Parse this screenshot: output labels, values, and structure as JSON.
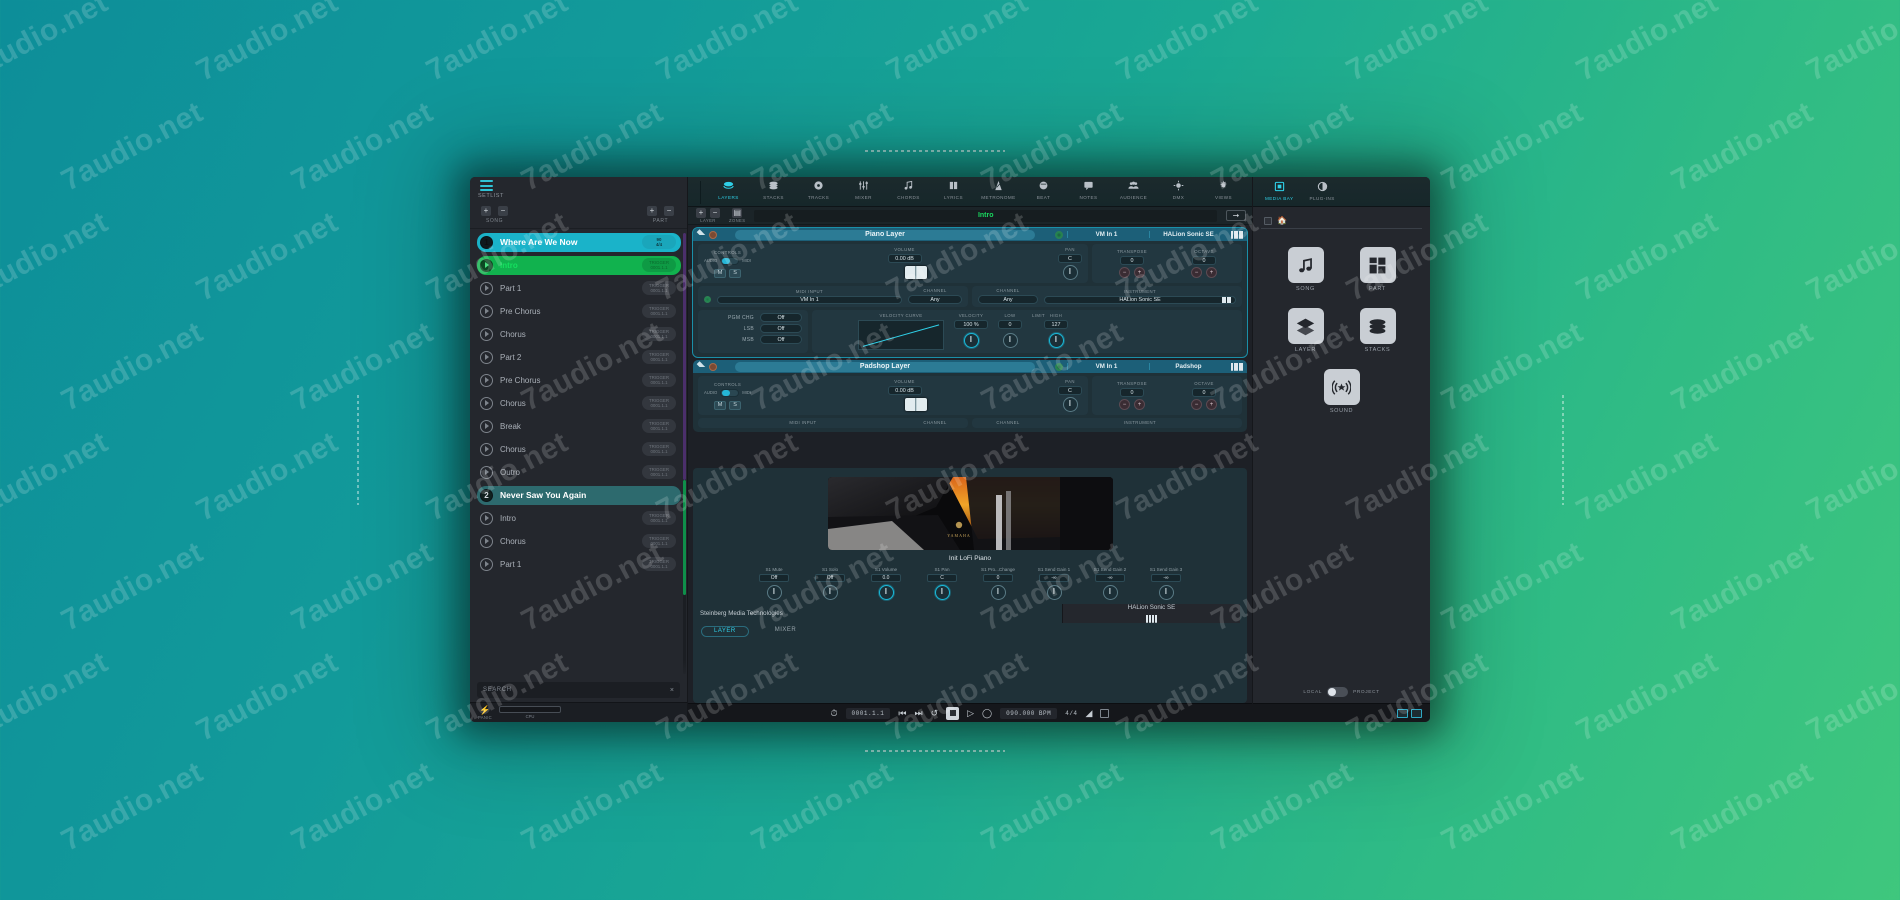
{
  "watermark": "7audio.net",
  "app": {
    "setlist": {
      "header_label": "SETLIST",
      "song_group_label": "SONG",
      "part_group_label": "PART",
      "add_icon": "plus-icon",
      "remove_icon": "minus-icon",
      "search_placeholder": "SEARCH",
      "search_clear": "×",
      "panic_label": "PANIC",
      "panic_icon": "lightning-icon",
      "cpu_label": "CPU",
      "items": [
        {
          "type": "song",
          "num": "1",
          "label": "Where Are We Now",
          "badge_line1": "90",
          "badge_line2": "4/4",
          "state": "selected"
        },
        {
          "type": "part",
          "label": "Intro",
          "badge_line1": "TRIGGER",
          "badge_line2": "0001.1.1",
          "state": "active"
        },
        {
          "type": "part",
          "label": "Part 1",
          "badge_line1": "TRIGGER",
          "badge_line2": "0001.1.1",
          "state": ""
        },
        {
          "type": "part",
          "label": "Pre Chorus",
          "badge_line1": "TRIGGER",
          "badge_line2": "0001.1.1",
          "state": ""
        },
        {
          "type": "part",
          "label": "Chorus",
          "badge_line1": "TRIGGER",
          "badge_line2": "0001.1.1",
          "state": ""
        },
        {
          "type": "part",
          "label": "Part 2",
          "badge_line1": "TRIGGER",
          "badge_line2": "0001.1.1",
          "state": ""
        },
        {
          "type": "part",
          "label": "Pre Chorus",
          "badge_line1": "TRIGGER",
          "badge_line2": "0001.1.1",
          "state": ""
        },
        {
          "type": "part",
          "label": "Chorus",
          "badge_line1": "TRIGGER",
          "badge_line2": "0001.1.1",
          "state": ""
        },
        {
          "type": "part",
          "label": "Break",
          "badge_line1": "TRIGGER",
          "badge_line2": "0001.1.1",
          "state": ""
        },
        {
          "type": "part",
          "label": "Chorus",
          "badge_line1": "TRIGGER",
          "badge_line2": "0001.1.1",
          "state": ""
        },
        {
          "type": "part",
          "label": "Outro",
          "badge_line1": "TRIGGER",
          "badge_line2": "0001.1.1",
          "state": ""
        },
        {
          "type": "song2",
          "num": "2",
          "label": "Never Saw You Again",
          "badge_line1": "",
          "badge_line2": "",
          "state": ""
        },
        {
          "type": "part",
          "label": "Intro",
          "badge_line1": "TRIGGER",
          "badge_line2": "0001.1.1",
          "state": ""
        },
        {
          "type": "part",
          "label": "Chorus",
          "badge_line1": "TRIGGER",
          "badge_line2": "0001.1.1",
          "state": ""
        },
        {
          "type": "part",
          "label": "Part 1",
          "badge_line1": "TRIGGER",
          "badge_line2": "0001.1.1",
          "state": ""
        }
      ]
    },
    "toolbar": [
      {
        "label": "LAYERS",
        "icon": "layers-icon",
        "active": true
      },
      {
        "label": "STACKS",
        "icon": "stacks-icon",
        "active": false
      },
      {
        "label": "TRACKS",
        "icon": "tracks-icon",
        "active": false
      },
      {
        "label": "MIXER",
        "icon": "mixer-icon",
        "active": false
      },
      {
        "label": "CHORDS",
        "icon": "chords-icon",
        "active": false
      },
      {
        "label": "LYRICS",
        "icon": "lyrics-icon",
        "active": false
      },
      {
        "label": "METRONOME",
        "icon": "metronome-icon",
        "active": false
      },
      {
        "label": "BEAT",
        "icon": "beat-icon",
        "active": false
      },
      {
        "label": "NOTES",
        "icon": "notes-icon",
        "active": false
      },
      {
        "label": "AUDIENCE",
        "icon": "audience-icon",
        "active": false
      },
      {
        "label": "DMX",
        "icon": "dmx-icon",
        "active": false
      },
      {
        "label": "VIEWS",
        "icon": "views-icon",
        "active": false
      }
    ],
    "right_toolbar": [
      {
        "label": "MEDIA BAY",
        "icon": "media-bay-icon",
        "active": true
      },
      {
        "label": "PLUG-INS",
        "icon": "plugins-icon",
        "active": false
      }
    ],
    "subbar": {
      "layer_label": "LAYER",
      "zones_label": "ZONES",
      "part_name": "Intro",
      "arrow_icon": "arrow-right-icon"
    },
    "layers": [
      {
        "name": "Piano Layer",
        "midi_in_tag": "VM In 1",
        "instrument_tag": "HALion Sonic SE",
        "selected": true,
        "controls_label": "CONTROLS",
        "audio_label": "AUDIO",
        "midi_label": "MIDI",
        "mute_label": "M",
        "solo_label": "S",
        "volume_label": "VOLUME",
        "volume_value": "0.00 dB",
        "pan_label": "PAN",
        "pan_value": "C",
        "transpose_label": "TRANSPOSE",
        "transpose_value": "0",
        "octave_label": "OCTAVE",
        "octave_value": "0",
        "midi_input_label": "MIDI INPUT",
        "midi_input_value": "VM In 1",
        "midi_channel_label": "CHANNEL",
        "midi_channel_value": "Any",
        "out_channel_label": "CHANNEL",
        "out_channel_value": "Any",
        "instrument_label": "INSTRUMENT",
        "instrument_value": "HALion Sonic SE",
        "pgm_chg_label": "PGM CHG",
        "pgm_chg_value": "Off",
        "lsb_label": "LSB",
        "lsb_value": "Off",
        "msb_label": "MSB",
        "msb_value": "Off",
        "velocity_curve_label": "VELOCITY CURVE",
        "velocity_label": "VELOCITY",
        "velocity_value": "100 %",
        "limit_label": "LIMIT",
        "low_label": "LOW",
        "low_value": "0",
        "high_label": "HIGH",
        "high_value": "127"
      },
      {
        "name": "Padshop Layer",
        "midi_in_tag": "VM In 1",
        "instrument_tag": "Padshop",
        "selected": false,
        "controls_label": "CONTROLS",
        "audio_label": "AUDIO",
        "midi_label": "MIDI",
        "mute_label": "M",
        "solo_label": "S",
        "volume_label": "VOLUME",
        "volume_value": "0.00 dB",
        "pan_label": "PAN",
        "pan_value": "C",
        "transpose_label": "TRANSPOSE",
        "transpose_value": "0",
        "octave_label": "OCTAVE",
        "octave_value": "0",
        "midi_input_label": "MIDI INPUT",
        "midi_channel_label": "CHANNEL",
        "out_channel_label": "CHANNEL",
        "instrument_label": "INSTRUMENT"
      }
    ],
    "instrument_editor": {
      "preset_name": "Init LoFi Piano",
      "image_alt": "grand-piano-photo",
      "brand": "Steinberg Media Technologies",
      "plugin_name": "HALion Sonic SE",
      "tabs": [
        {
          "label": "LAYER",
          "active": true
        },
        {
          "label": "MIXER",
          "active": false
        }
      ],
      "params": [
        {
          "label": "S1 Mute",
          "value": "Off",
          "highlight": false
        },
        {
          "label": "S1 Solo",
          "value": "Off",
          "highlight": false
        },
        {
          "label": "S1 Volume",
          "value": "0.0",
          "highlight": true
        },
        {
          "label": "S1 Pan",
          "value": "C",
          "highlight": true
        },
        {
          "label": "S1 Pro...Change",
          "value": "0",
          "highlight": false
        },
        {
          "label": "S1 Send Gain 1",
          "value": "-∞",
          "highlight": false
        },
        {
          "label": "S1 Send Gain 2",
          "value": "-∞",
          "highlight": false
        },
        {
          "label": "S1 Send Gain 3",
          "value": "-∞",
          "highlight": false
        }
      ]
    },
    "transport": {
      "metronome_icon": "metronome-icon",
      "position": "0001.1.1",
      "rewind_icon": "skip-back-icon",
      "forward_icon": "skip-forward-icon",
      "cycle_icon": "cycle-icon",
      "stop_icon": "stop-icon",
      "play_icon": "play-icon",
      "record_icon": "record-icon",
      "tempo": "090.000 BPM",
      "time_signature": "4/4",
      "tempo_track_icon": "tempo-track-icon",
      "click_icon": "click-toggle-icon"
    },
    "media_bay": {
      "home_icon": "home-icon",
      "checkbox_icon": "checkbox-icon",
      "cells": [
        {
          "label": "SONG",
          "icon": "music-note-icon"
        },
        {
          "label": "PART",
          "icon": "grid-squares-icon"
        },
        {
          "label": "LAYER",
          "icon": "layers-stack-icon"
        },
        {
          "label": "STACKS",
          "icon": "stacks-disc-icon"
        },
        {
          "label": "SOUND",
          "icon": "sound-wave-icon"
        }
      ],
      "local_label": "LOCAL",
      "project_label": "PROJECT"
    },
    "colors": {
      "accent_cyan": "#2fd0e8",
      "accent_green": "#15e05f",
      "song_blue": "#1ab3c9",
      "layer_header": "#1c5f78",
      "panel_bg": "#223740",
      "window_bg": "#1f2228"
    }
  }
}
